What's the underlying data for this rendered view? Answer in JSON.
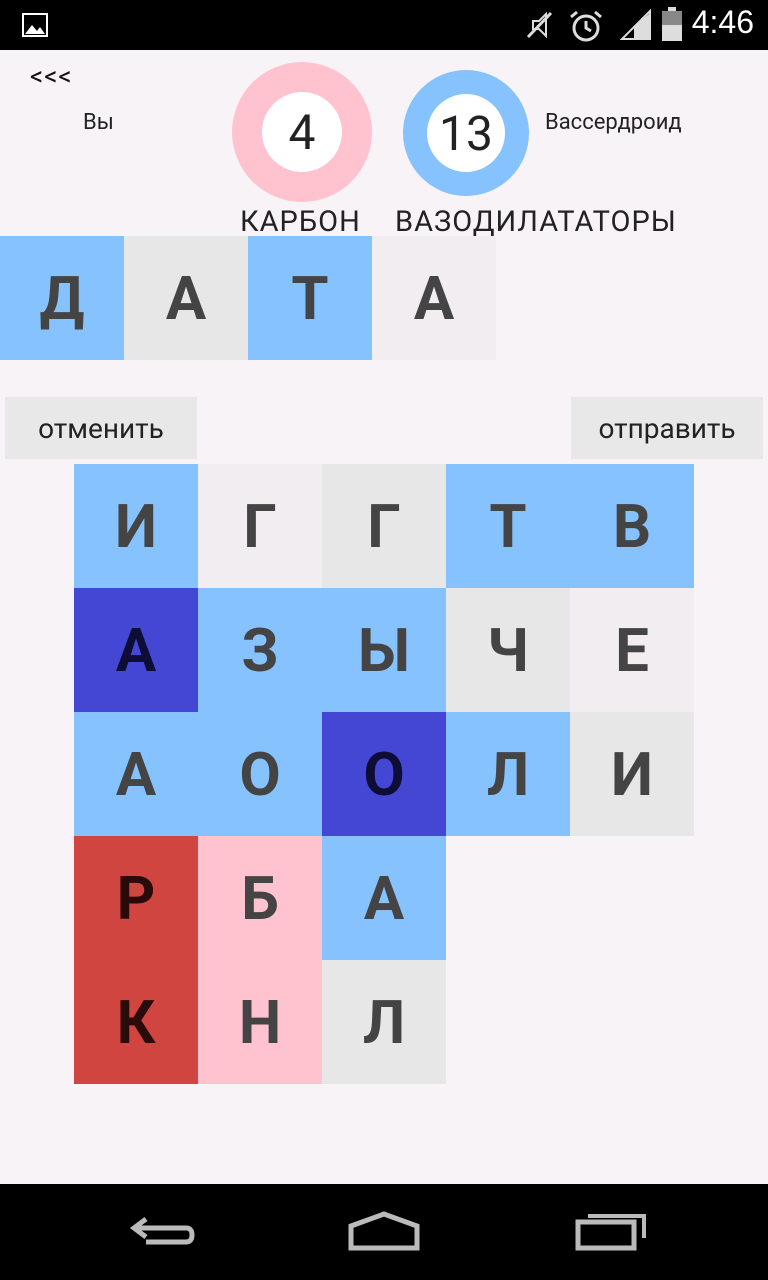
{
  "status_bar": {
    "time": "4:46",
    "icons": [
      "image-notification-icon",
      "mute-icon",
      "alarm-icon",
      "signal-icon",
      "battery-icon"
    ]
  },
  "header": {
    "back_label": "<<<",
    "player": {
      "name": "Вы",
      "score": "4",
      "last_word": "КАРБОН"
    },
    "opponent": {
      "name": "Вассердроид",
      "score": "13",
      "last_word": "ВАЗОДИЛАТАТОРЫ"
    }
  },
  "current_word": [
    "Д",
    "А",
    "Т",
    "А"
  ],
  "buttons": {
    "cancel": "отменить",
    "submit": "отправить"
  },
  "board": {
    "rows": [
      [
        "И",
        "Г",
        "Г",
        "Т",
        "В"
      ],
      [
        "А",
        "З",
        "Ы",
        "Ч",
        "Е"
      ],
      [
        "А",
        "О",
        "О",
        "Л",
        "И"
      ],
      [
        "Р",
        "Б",
        "А"
      ],
      [
        "К",
        "Н",
        "Л"
      ]
    ]
  },
  "colors": {
    "opponent_light": "#86c2fe",
    "opponent_dark": "#4447d4",
    "player_light": "#ffc2cf",
    "player_dark": "#d14541",
    "neutral": "#e7e7e7",
    "neutral_light": "#f1edf1",
    "background": "#f7f3f7"
  },
  "nav_bar": {
    "icons": [
      "back-icon",
      "home-icon",
      "recents-icon"
    ]
  }
}
